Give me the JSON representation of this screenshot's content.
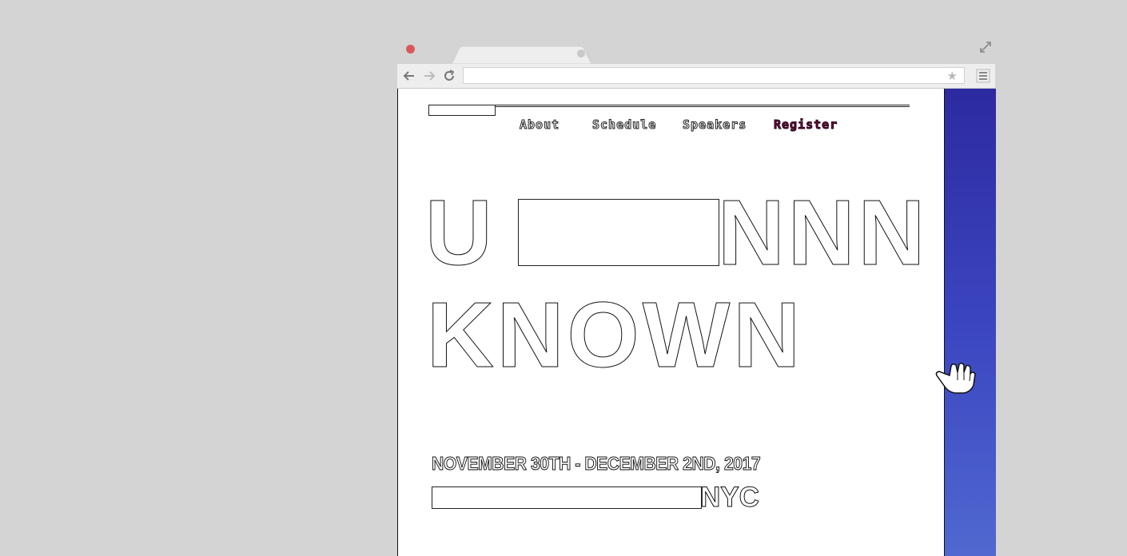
{
  "nav": {
    "about": "About",
    "schedule": "Schedule",
    "speakers": "Speakers",
    "register": "Register"
  },
  "hero": {
    "line1_start": "U",
    "line1_end": "NNN",
    "line2": "KNOWN"
  },
  "event": {
    "dates": "NOVEMBER 30TH - DECEMBER 2ND, 2017",
    "city": "NYC"
  },
  "colors": {
    "sidebar_top": "#2d2aa0",
    "sidebar_bottom": "#5068d0",
    "register": "#6a1044",
    "close_button": "#d8585a"
  },
  "icons": {
    "toolbar": [
      "back-arrow-icon",
      "forward-arrow-icon",
      "reload-icon",
      "star-icon",
      "hamburger-menu-icon"
    ],
    "window": [
      "close-dot-icon",
      "expand-icon"
    ],
    "pointer": "hand-cursor-icon"
  }
}
